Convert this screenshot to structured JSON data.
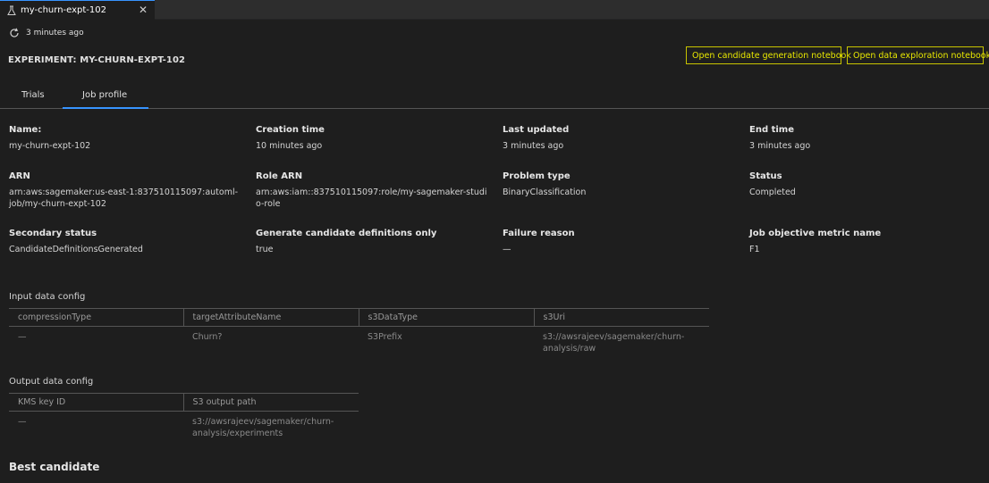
{
  "tab": {
    "title": "my-churn-expt-102",
    "close": "✕"
  },
  "refresh": {
    "text": "3 minutes ago"
  },
  "experiment_title": "EXPERIMENT: MY-CHURN-EXPT-102",
  "buttons": {
    "candidate": "Open candidate generation notebook",
    "exploration": "Open data exploration notebook"
  },
  "subtabs": [
    "Trials",
    "Job profile"
  ],
  "fields": {
    "name": {
      "label": "Name:",
      "value": "my-churn-expt-102"
    },
    "creation_time": {
      "label": "Creation time",
      "value": "10 minutes ago"
    },
    "last_updated": {
      "label": "Last updated",
      "value": "3 minutes ago"
    },
    "end_time": {
      "label": "End time",
      "value": "3 minutes ago"
    },
    "arn": {
      "label": "ARN",
      "value": "arn:aws:sagemaker:us-east-1:837510115097:automl-job/my-churn-expt-102"
    },
    "role_arn": {
      "label": "Role ARN",
      "value": "arn:aws:iam::837510115097:role/my-sagemaker-studio-role"
    },
    "problem_type": {
      "label": "Problem type",
      "value": "BinaryClassification"
    },
    "status": {
      "label": "Status",
      "value": "Completed"
    },
    "secondary_status": {
      "label": "Secondary status",
      "value": "CandidateDefinitionsGenerated"
    },
    "generate_only": {
      "label": "Generate candidate definitions only",
      "value": "true"
    },
    "failure_reason": {
      "label": "Failure reason",
      "value": "—"
    },
    "objective_metric": {
      "label": "Job objective metric name",
      "value": "F1"
    }
  },
  "input_config": {
    "label": "Input data config",
    "headers": [
      "compressionType",
      "targetAttributeName",
      "s3DataType",
      "s3Uri"
    ],
    "row": [
      "—",
      "Churn?",
      "S3Prefix",
      "s3://awsrajeev/sagemaker/churn-analysis/raw"
    ]
  },
  "output_config": {
    "label": "Output data config",
    "headers": [
      "KMS key ID",
      "S3 output path"
    ],
    "row": [
      "—",
      "s3://awsrajeev/sagemaker/churn-analysis/experiments"
    ]
  },
  "best_candidate": "Best candidate",
  "colors": {
    "accent": "#3794ff",
    "button": "#e8e800",
    "background": "#1e1e1e"
  }
}
